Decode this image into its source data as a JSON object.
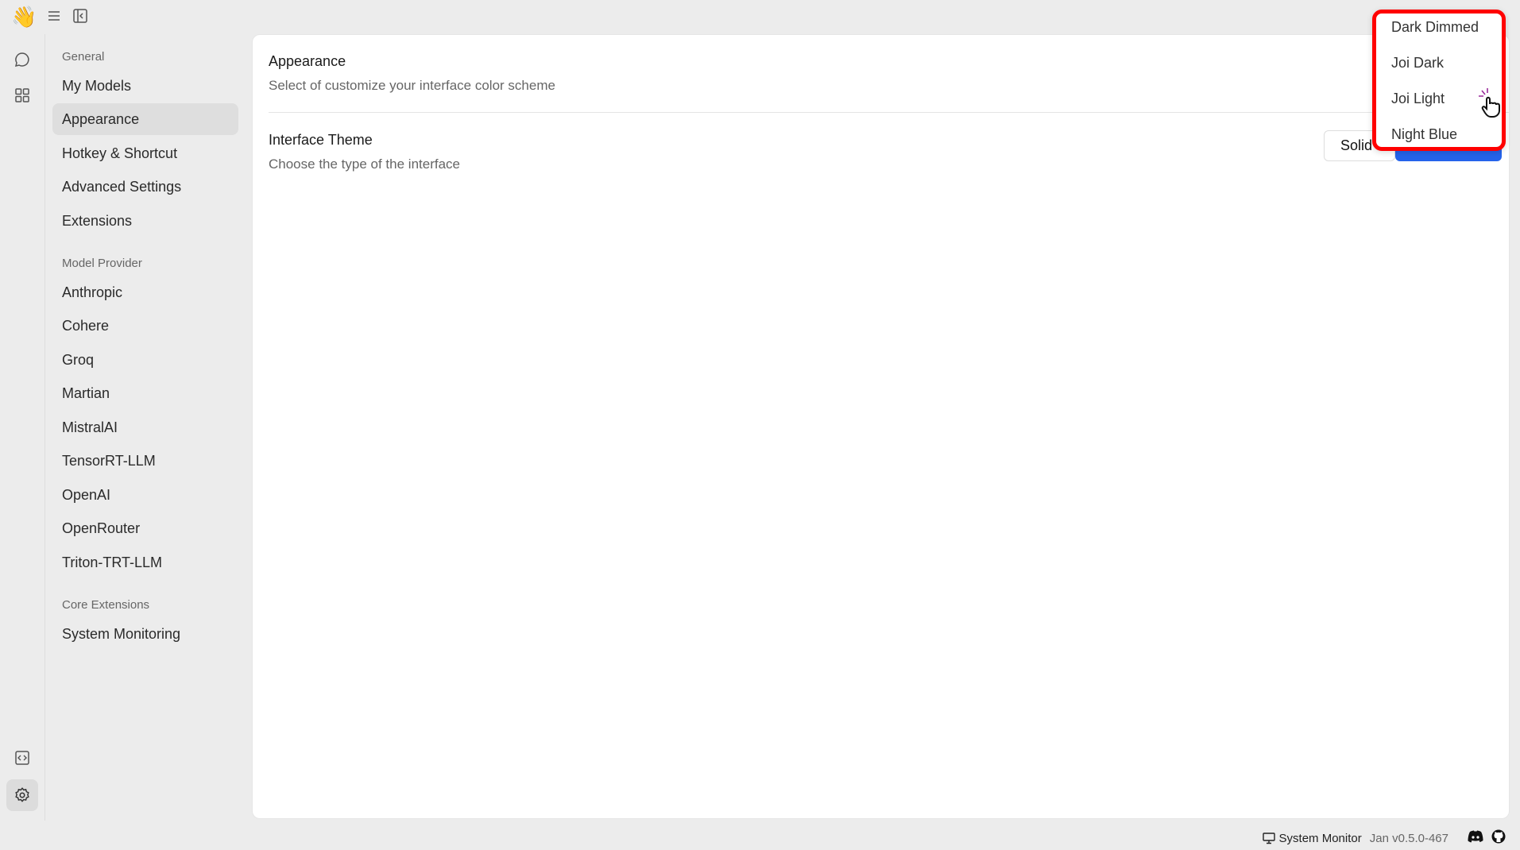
{
  "app": {
    "logo": "👋"
  },
  "sidebar": {
    "sections": [
      {
        "label": "General",
        "items": [
          "My Models",
          "Appearance",
          "Hotkey & Shortcut",
          "Advanced Settings",
          "Extensions"
        ]
      },
      {
        "label": "Model Provider",
        "items": [
          "Anthropic",
          "Cohere",
          "Groq",
          "Martian",
          "MistralAI",
          "TensorRT-LLM",
          "OpenAI",
          "OpenRouter",
          "Triton-TRT-LLM"
        ]
      },
      {
        "label": "Core Extensions",
        "items": [
          "System Monitoring"
        ]
      }
    ],
    "selected": "Appearance"
  },
  "main": {
    "title": "Appearance",
    "subtitle": "Select of customize your interface color scheme",
    "theme_title": "Interface Theme",
    "theme_subtitle": "Choose the type of the interface",
    "solid_label": "Solid"
  },
  "dropdown": {
    "options": [
      "Dark Dimmed",
      "Joi Dark",
      "Joi Light",
      "Night Blue"
    ],
    "hovered": "Joi Light"
  },
  "footer": {
    "system_monitor": "System Monitor",
    "version": "Jan v0.5.0-467"
  },
  "colors": {
    "accent": "#2563eb",
    "highlight": "#ff0000"
  }
}
